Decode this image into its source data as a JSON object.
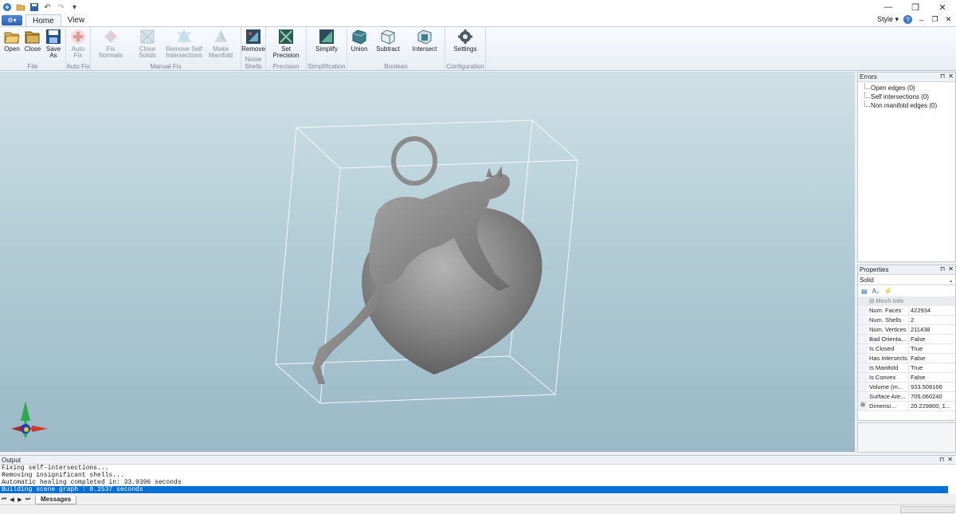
{
  "titlebar": {
    "quick_access": [
      "app-icon",
      "open-icon",
      "save-icon",
      "undo-icon",
      "redo-icon",
      "customize-icon"
    ],
    "controls": [
      "minimize-icon",
      "restore-icon",
      "close-icon"
    ]
  },
  "tabs": {
    "home": "Home",
    "view": "View",
    "style_label": "Style"
  },
  "ribbon": {
    "groups": [
      {
        "label": "File",
        "buttons": [
          {
            "line1": "Open",
            "line2": "",
            "icon": "open-folder-icon",
            "enabled": true
          },
          {
            "line1": "Close",
            "line2": "",
            "icon": "close-folder-icon",
            "enabled": true
          },
          {
            "line1": "Save",
            "line2": "As",
            "icon": "save-as-icon",
            "enabled": true
          }
        ]
      },
      {
        "label": "Auto Fix",
        "buttons": [
          {
            "line1": "Auto",
            "line2": "Fix",
            "icon": "auto-fix-icon",
            "enabled": false
          }
        ]
      },
      {
        "label": "Manual Fix",
        "buttons": [
          {
            "line1": "Fix",
            "line2": "Normals",
            "icon": "fix-normals-icon",
            "enabled": false
          },
          {
            "line1": "Close",
            "line2": "Solids",
            "icon": "close-solids-icon",
            "enabled": false
          },
          {
            "line1": "Remove Self",
            "line2": "Intersections",
            "icon": "remove-self-intersections-icon",
            "enabled": false
          },
          {
            "line1": "Make",
            "line2": "Manifold",
            "icon": "make-manifold-icon",
            "enabled": false
          }
        ]
      },
      {
        "label": "Noise Shells",
        "buttons": [
          {
            "line1": "Remove",
            "line2": "",
            "icon": "remove-noise-shells-icon",
            "enabled": true
          }
        ]
      },
      {
        "label": "Precision",
        "buttons": [
          {
            "line1": "Set",
            "line2": "Precision",
            "icon": "set-precision-icon",
            "enabled": true
          }
        ]
      },
      {
        "label": "Simplification",
        "buttons": [
          {
            "line1": "Simplify",
            "line2": "",
            "icon": "simplify-icon",
            "enabled": true
          }
        ]
      },
      {
        "label": "Boolean",
        "buttons": [
          {
            "line1": "Union",
            "line2": "",
            "icon": "union-icon",
            "enabled": true
          },
          {
            "line1": "Subtract",
            "line2": "",
            "icon": "subtract-icon",
            "enabled": true
          },
          {
            "line1": "Intersect",
            "line2": "",
            "icon": "intersect-icon",
            "enabled": true
          }
        ]
      },
      {
        "label": "Configuration",
        "buttons": [
          {
            "line1": "Settings",
            "line2": "",
            "icon": "settings-gear-icon",
            "enabled": true
          }
        ]
      }
    ]
  },
  "errors_panel": {
    "title": "Errors",
    "items": [
      "Open edges (0)",
      "Self intersections (0)",
      "Non manifold edges (0)"
    ]
  },
  "properties_panel": {
    "title": "Properties",
    "object": "Solid",
    "category": "Mesh Info",
    "rows": [
      {
        "key": "Num. Faces",
        "value": "422934"
      },
      {
        "key": "Num. Shells",
        "value": "2"
      },
      {
        "key": "Num. Vertices",
        "value": "211438"
      },
      {
        "key": "Bad Orienta...",
        "value": "False"
      },
      {
        "key": "Is Closed",
        "value": "True"
      },
      {
        "key": "Has Intersects",
        "value": "False"
      },
      {
        "key": "Is Manifold",
        "value": "True"
      },
      {
        "key": "Is Convex",
        "value": "False"
      },
      {
        "key": "Volume (m...",
        "value": "933.508166"
      },
      {
        "key": "Surface Are...",
        "value": "705.060240"
      },
      {
        "key": "Dimensi...",
        "value": "20.229800, 1..."
      }
    ]
  },
  "output_panel": {
    "title": "Output",
    "lines": [
      "Fixing self-intersections...",
      "Removing insignificant shells...",
      "Automatic healing completed in: 33.9396 seconds",
      "Building scene graph : 0.2537 seconds"
    ],
    "tab": "Messages"
  },
  "colors": {
    "model": "#8a8a8a",
    "selection": "#0a6fd6",
    "viewport_top": "#cfe1e6",
    "viewport_bottom": "#9ab8c7"
  }
}
